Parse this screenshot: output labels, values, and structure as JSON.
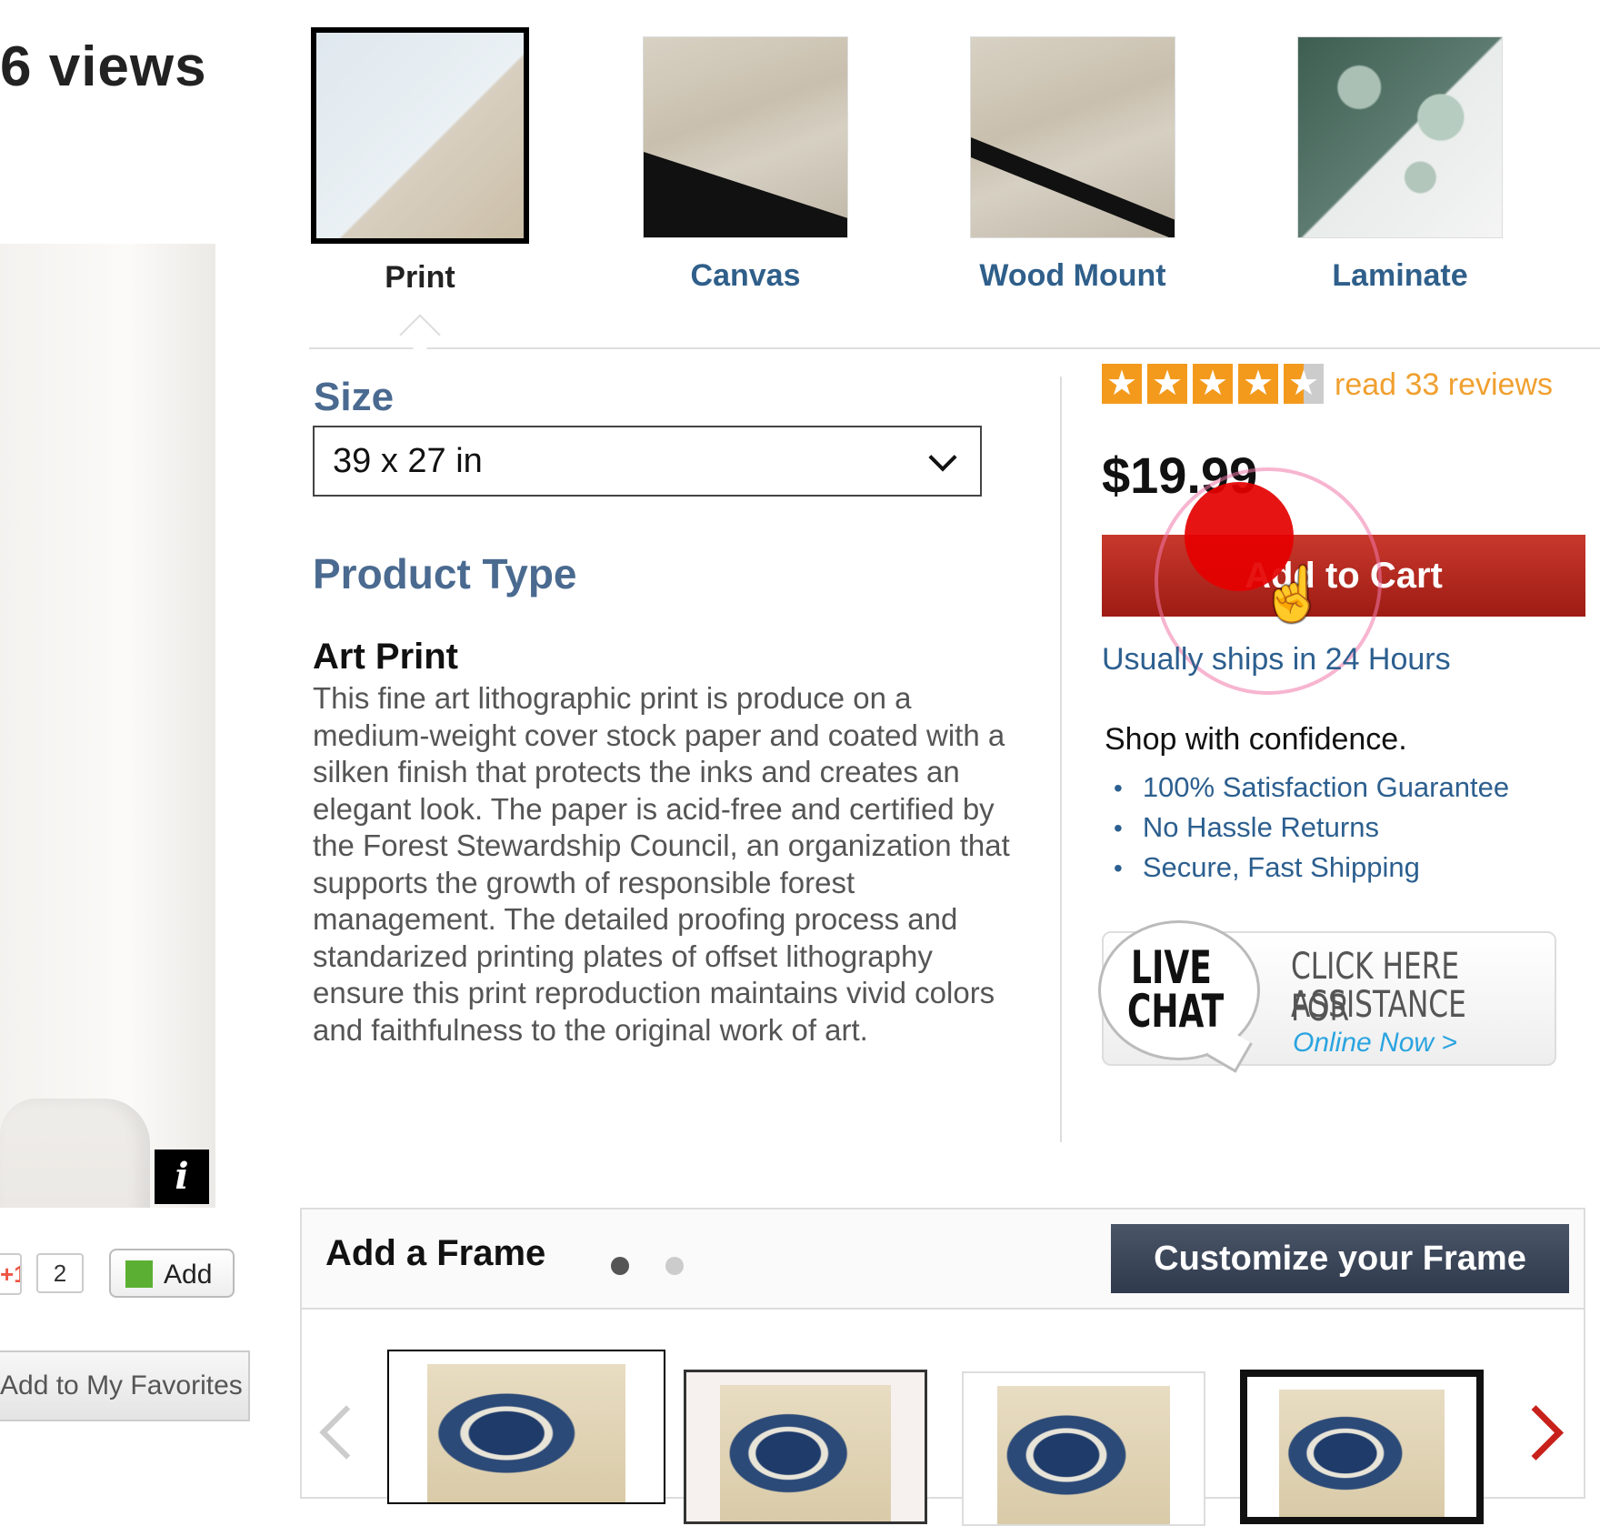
{
  "views_text": "6 views",
  "product_tabs": [
    {
      "label": "Print",
      "selected": true
    },
    {
      "label": "Canvas",
      "selected": false
    },
    {
      "label": "Wood Mount",
      "selected": false
    },
    {
      "label": "Laminate",
      "selected": false
    }
  ],
  "size": {
    "label": "Size",
    "value": "39 x 27 in"
  },
  "product_type": {
    "heading": "Product Type",
    "name": "Art Print",
    "description": "This fine art lithographic print is produce on a medium-weight cover stock paper and coated with a silken finish that protects the inks and creates an elegant look. The paper is acid-free and certified by the Forest Stewardship Council, an organization that supports the growth of responsible forest management. The detailed proofing process and standarized printing plates of offset lithography ensure this print reproduction maintains vivid colors and faithfulness to the original work of art."
  },
  "rating": {
    "stars": 4.5,
    "reviews_link": "read 33 reviews"
  },
  "price": "$19.99",
  "add_to_cart_label": "Add to Cart",
  "shipping_note": "Usually ships in 24 Hours",
  "confidence": {
    "title": "Shop with confidence.",
    "items": [
      "100% Satisfaction Guarantee",
      "No Hassle Returns",
      "Secure, Fast Shipping"
    ]
  },
  "live_chat": {
    "line1": "LIVE",
    "line2": "CHAT",
    "assist_line1": "CLICK HERE FOR",
    "assist_line2": "ASSISTANCE",
    "status": "Online Now >"
  },
  "social": {
    "plus_one": "+1",
    "plus_count": "2",
    "add_label": "Add",
    "favorites_label": "Add to My Favorites"
  },
  "info_badge": "i",
  "frame_section": {
    "title": "Add a Frame",
    "customize_label": "Customize your Frame"
  },
  "colors": {
    "accent_blue": "#2f5f8a",
    "cart_red": "#b02a20",
    "star_orange": "#f39a1d",
    "customize_navy": "#3b4659"
  }
}
